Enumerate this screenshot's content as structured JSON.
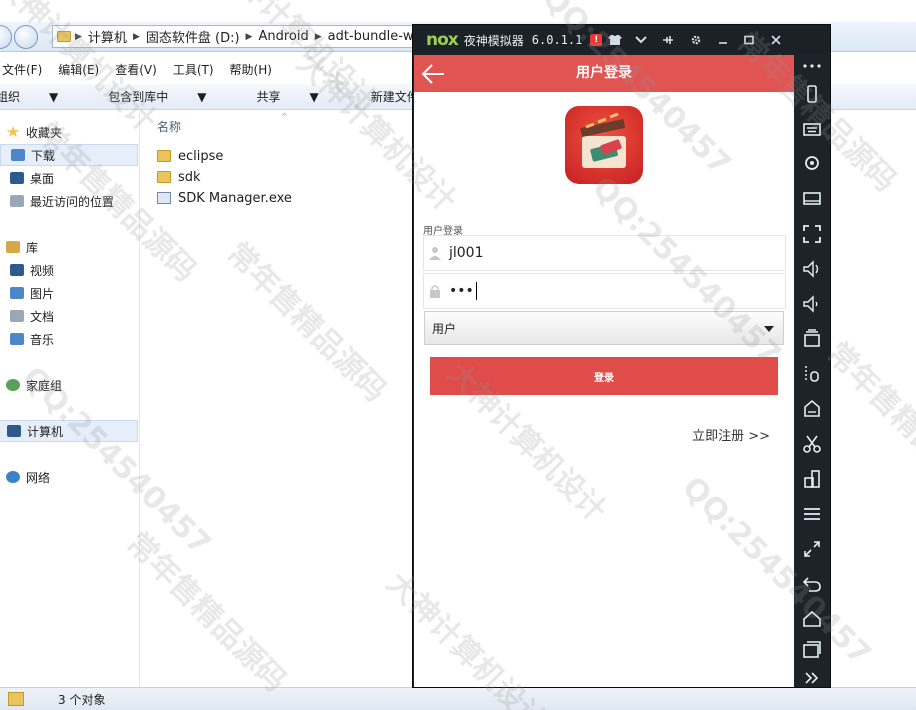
{
  "explorer": {
    "breadcrumbs": [
      "计算机",
      "固态软件盘 (D:)",
      "Android",
      "adt-bundle-w"
    ],
    "menu": [
      "文件(F)",
      "编辑(E)",
      "查看(V)",
      "工具(T)",
      "帮助(H)"
    ],
    "toolbar": {
      "organize": "组织",
      "include_in_library": "包含到库中",
      "share": "共享",
      "new_folder": "新建文件夹"
    },
    "nav": {
      "favorites": "收藏夹",
      "downloads": "下载",
      "desktop": "桌面",
      "recent": "最近访问的位置",
      "libraries": "库",
      "videos": "视频",
      "pictures": "图片",
      "documents": "文档",
      "music": "音乐",
      "homegroup": "家庭组",
      "computer": "计算机",
      "network": "网络"
    },
    "column_name": "名称",
    "files": [
      {
        "name": "eclipse",
        "type": "folder"
      },
      {
        "name": "sdk",
        "type": "folder"
      },
      {
        "name": "SDK Manager.exe",
        "type": "exe"
      }
    ],
    "status": "3 个对象"
  },
  "emulator": {
    "logo": "nox",
    "name": "夜神模拟器",
    "version": "6.0.1.1",
    "badge": "!",
    "sidebar_icons": [
      "more-icon",
      "phone-rotate-icon",
      "keyboard-icon",
      "location-icon",
      "screen-icon",
      "fullscreen-icon",
      "volume-up-icon",
      "volume-down-icon",
      "shake-icon",
      "macro-icon",
      "apk-icon",
      "scissors-icon",
      "multi-instance-icon",
      "menu-icon",
      "expand-icon",
      "back-icon",
      "home-icon",
      "recent-apps-icon",
      "more-arrow-icon"
    ]
  },
  "app": {
    "title": "用户登录",
    "section_label": "用户登录",
    "username": "jl001",
    "password": "•••",
    "role": "用户",
    "login_button": "登录",
    "register_link": "立即注册 >>",
    "accent_color": "#e05452"
  },
  "watermarks": [
    "常年售精品源码",
    "大神计算机设计",
    "QQ:254540457"
  ]
}
